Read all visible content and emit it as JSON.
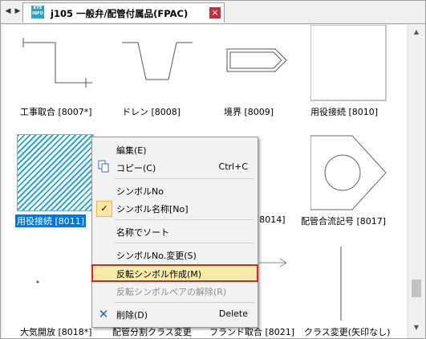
{
  "tab": {
    "icon_text": "KYE\nINFO",
    "title": "j105 一般弁/配管付属品(FPAC)",
    "close": "×"
  },
  "nav": {
    "left": "◀",
    "right": "▶"
  },
  "scroll": {
    "up": "▲",
    "down": "▼"
  },
  "symbols": [
    {
      "label": "工事取合 [8007*]"
    },
    {
      "label": "ドレン [8008]"
    },
    {
      "label": "境界 [8009]"
    },
    {
      "label": "用役接続 [8010]"
    },
    {
      "label": "用役接続 [8011]",
      "selected": true
    },
    {
      "label": ""
    },
    {
      "label": "[8014]"
    },
    {
      "label": "配管合流記号 [8017]"
    },
    {
      "label": "大気開放 [8018*]"
    },
    {
      "label": "配管分割クラス変更"
    },
    {
      "label": "フランド取合 [8021]"
    },
    {
      "label": "クラス変更(矢印なし)"
    }
  ],
  "menu": {
    "edit": "編集(E)",
    "copy": "コピー(C)",
    "copy_shortcut": "Ctrl+C",
    "symbol_no": "シンボルNo",
    "symbol_name": "シンボル名称[No]",
    "sort_by_name": "名称でソート",
    "change_symbol_no": "シンボルNo.変更(S)",
    "create_reverse": "反転シンボル作成(M)",
    "release_reverse_pair": "反転シンボルペアの解除(R)",
    "delete": "削除(D)",
    "delete_shortcut": "Delete"
  },
  "colors": {
    "selection": "#0078d7",
    "highlight": "#fbe9a8",
    "highlight_border": "#e0202a",
    "delete_icon": "#1f5fbf"
  }
}
